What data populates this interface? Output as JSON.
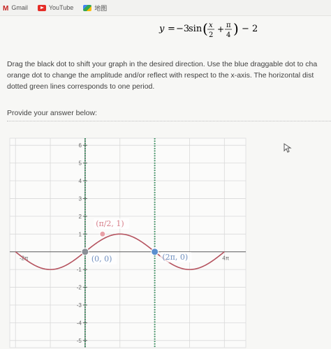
{
  "bookmarks": [
    {
      "label": "Gmail",
      "icon": "gmail-icon"
    },
    {
      "label": "YouTube",
      "icon": "youtube-icon"
    },
    {
      "label": "地图",
      "icon": "maps-icon"
    }
  ],
  "equation": {
    "lhs": "y",
    "coefficient": "−3",
    "func": "sin",
    "frac1_num": "x",
    "frac1_den": "2",
    "frac2_num": "π",
    "frac2_den": "4",
    "constant": "− 2"
  },
  "instructions": {
    "line1": "Drag the black dot to shift your graph in the desired direction. Use the blue draggable dot to cha",
    "line2": "orange dot to change the amplitude and/or reflect with respect to the x-axis. The horizontal dist",
    "line3": "dotted green lines corresponds to one period."
  },
  "prompt": "Provide your answer below:",
  "graph": {
    "y_tick_labels": [
      "6",
      "5",
      "4",
      "3",
      "2",
      "1",
      "-1",
      "-2",
      "-3",
      "-4",
      "-5"
    ],
    "x_tick_labels": [
      "-2π",
      "4π"
    ],
    "point_labels": [
      "(0, 0)",
      "(π/2, 1)",
      "(2π, 0)"
    ],
    "x_range": [
      -6.8,
      14.5
    ],
    "y_range": [
      -5.4,
      6.4
    ],
    "curve": {
      "amplitude": 1,
      "period_divisor": 2,
      "color": "#b5525e"
    },
    "period_lines_x": [
      0,
      6.283
    ],
    "dots": [
      {
        "name": "black-dot",
        "x": 0,
        "y": 0,
        "color": "#8a8f96"
      },
      {
        "name": "blue-dot",
        "x": 6.283,
        "y": 0,
        "color": "#5b8fcf"
      },
      {
        "name": "orange-dot",
        "x": 1.571,
        "y": 1,
        "color": "#e8a0a6"
      }
    ],
    "colors": {
      "axis": "#5a5a5a",
      "grid": "#d9d9d9",
      "period_line": "#2e8b57",
      "label_text": "#6f8fbf",
      "pink_label": "#d77e89"
    }
  }
}
